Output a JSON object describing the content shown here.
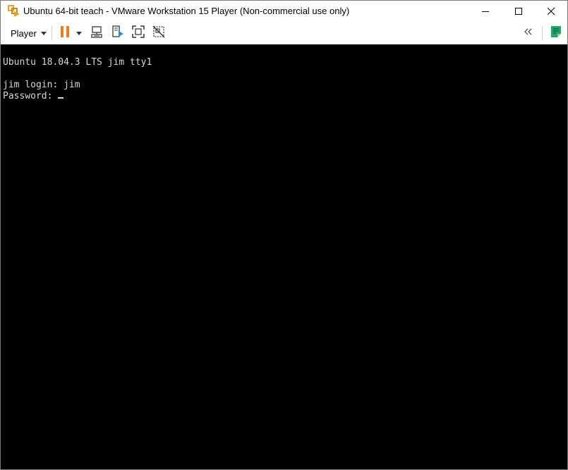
{
  "window": {
    "title": "Ubuntu 64-bit teach - VMware Workstation 15 Player (Non-commercial use only)",
    "icon": "vmware-player-icon",
    "controls": {
      "minimize": "minimize-icon",
      "maximize": "maximize-icon",
      "close": "close-icon"
    }
  },
  "toolbar": {
    "player_menu_label": "Player",
    "buttons": [
      {
        "name": "pause",
        "icon": "pause-icon",
        "color": "#f07c1e"
      },
      {
        "name": "send-ctrl-alt-del",
        "icon": "ctrl-alt-del-icon"
      },
      {
        "name": "removable-devices",
        "icon": "removable-devices-icon"
      },
      {
        "name": "full-screen",
        "icon": "full-screen-icon"
      },
      {
        "name": "unity",
        "icon": "unity-icon"
      },
      {
        "name": "collapse-library",
        "icon": "double-chevron-left-icon"
      },
      {
        "name": "library",
        "icon": "library-icon",
        "color": "#23a86b"
      }
    ]
  },
  "console": {
    "lines": [
      "Ubuntu 18.04.3 LTS jim tty1",
      "jim login: jim",
      "Password: "
    ],
    "background": "#000000",
    "text_color": "#d8d8d8"
  }
}
